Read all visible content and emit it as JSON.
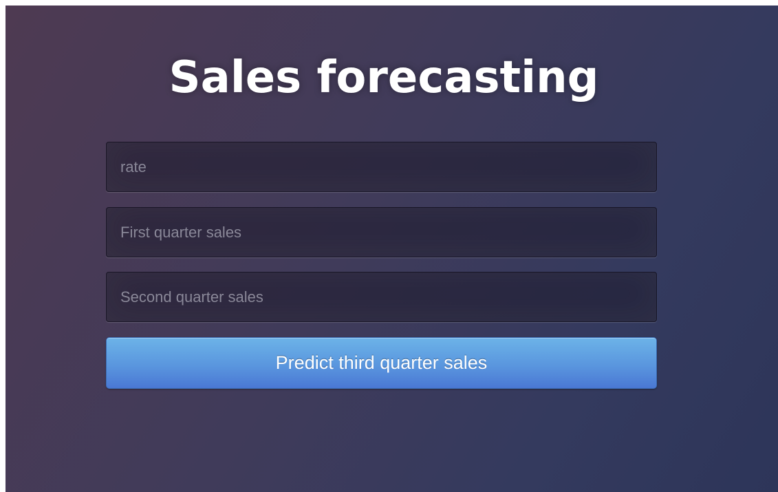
{
  "page": {
    "title": "Sales forecasting"
  },
  "form": {
    "rate_placeholder": "rate",
    "first_quarter_placeholder": "First quarter sales",
    "second_quarter_placeholder": "Second quarter sales",
    "submit_label": "Predict third quarter sales"
  },
  "colors": {
    "background_start": "#4e3a52",
    "background_end": "#2d3559",
    "button_top": "#6cb3e8",
    "button_bottom": "#4a78d4",
    "title_text": "#ffffff"
  }
}
